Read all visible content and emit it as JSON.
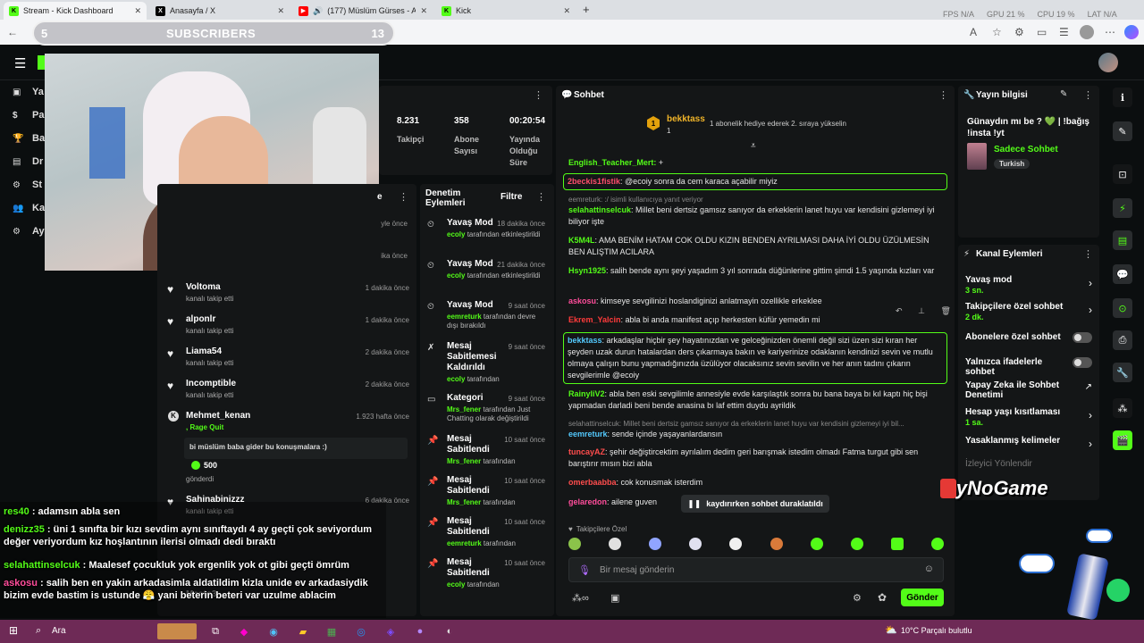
{
  "browser": {
    "tabs": [
      "Stream - Kick Dashboard",
      "Anasayfa / X",
      "(177) Müslüm Gürses - Affet",
      "Kick"
    ],
    "perf": {
      "fps": "FPS N/A",
      "gpu": "GPU 21 %",
      "cpu": "CPU 19 %",
      "lat": "LAT N/A"
    }
  },
  "subs_overlay": {
    "left": "5",
    "label": "SUBSCRIBERS",
    "right": "13"
  },
  "nav": [
    {
      "label": "Ya",
      "icon": "video-icon"
    },
    {
      "label": "Pa",
      "icon": "dollar-icon"
    },
    {
      "label": "Ba",
      "icon": "trophy-icon"
    },
    {
      "label": "Dr",
      "icon": "gift-icon"
    },
    {
      "label": "St",
      "icon": "gear-icon"
    },
    {
      "label": "Ka",
      "icon": "users-icon"
    },
    {
      "label": "Ay",
      "icon": "gear-icon"
    }
  ],
  "stats": [
    {
      "value": "8.231",
      "label": "Takipçi"
    },
    {
      "value": "358",
      "label": "Abone Sayısı"
    },
    {
      "value": "00:20:54",
      "label": "Yayında Olduğu Süre"
    }
  ],
  "activity": {
    "header_suffix": "e",
    "items": [
      {
        "name": "Voltoma",
        "sub": "kanalı takip etti",
        "time": "1 dakika önce"
      },
      {
        "name": "alponlr",
        "sub": "kanalı takip etti",
        "time": "1 dakika önce"
      },
      {
        "name": "Liama54",
        "sub": "kanalı takip etti",
        "time": "2 dakika önce"
      },
      {
        "name": "Incomptible",
        "sub": "kanalı takip etti",
        "time": "2 dakika önce"
      },
      {
        "name": "Mehmet_kenan",
        "sub": ", Rage Quit",
        "time": "1.923 hafta önce"
      },
      {
        "name": "Sahinabinizzz",
        "sub": "kanalı takip etti",
        "time": "6 dakika önce"
      }
    ],
    "partial_time_1": "yle önce",
    "partial_time_2": "ika önce",
    "mehmet_message": "bi müslüm baba gider bu konuşmalara :)",
    "mehmet_amount": "500",
    "mehmet_footer": "gönderdi",
    "bottom_partial": "Mceto3"
  },
  "mod": {
    "title": "Denetim Eylemleri",
    "filter": "Filtre",
    "items": [
      {
        "title": "Yavaş Mod",
        "time": "18 dakika önce",
        "user": "ecoly",
        "desc": "tarafından etkinleştirildi",
        "icon": "slow-mode-icon"
      },
      {
        "title": "Yavaş Mod",
        "time": "21 dakika önce",
        "user": "ecoly",
        "desc": "tarafından etkinleştirildi",
        "icon": "slow-mode-icon"
      },
      {
        "title": "Yavaş Mod",
        "time": "9 saat önce",
        "user": "eemreturk",
        "desc": "tarafından devre dışı bırakıldı",
        "icon": "slow-mode-icon"
      },
      {
        "title": "Mesaj Sabitlemesi Kaldırıldı",
        "time": "9 saat önce",
        "user": "ecoly",
        "desc": "tarafından",
        "icon": "unpin-icon"
      },
      {
        "title": "Kategori",
        "time": "9 saat önce",
        "user": "Mrs_fener",
        "desc": "tarafından Just Chatting olarak değiştirildi",
        "icon": "category-icon"
      },
      {
        "title": "Mesaj Sabitlendi",
        "time": "10 saat önce",
        "user": "Mrs_fener",
        "desc": "tarafından",
        "icon": "pin-icon"
      },
      {
        "title": "Mesaj Sabitlendi",
        "time": "10 saat önce",
        "user": "Mrs_fener",
        "desc": "tarafından",
        "icon": "pin-icon"
      },
      {
        "title": "Mesaj Sabitlendi",
        "time": "10 saat önce",
        "user": "eemreturk",
        "desc": "tarafından",
        "icon": "pin-icon"
      },
      {
        "title": "Mesaj Sabitlendi",
        "time": "10 saat önce",
        "user": "ecoly",
        "desc": "tarafından",
        "icon": "pin-icon"
      }
    ]
  },
  "chat": {
    "title": "Sohbet",
    "top_user": "bekktass",
    "top_rank": "1",
    "top_count": "1",
    "top_note": "1 abonelik hediye ederek 2. sıraya yükselin",
    "messages": [
      {
        "user": "English_Teacher_Mert:",
        "text": " +",
        "color": "#53fc18"
      },
      {
        "user": "2beckis1fistik",
        "text": ": @ecoiy sonra da cem karaca açabilir miyiz",
        "color": "#ff4d6d",
        "boxed": true
      },
      {
        "reply": "eemreturk: :/ isimli kullanıcıya yanıt veriyor"
      },
      {
        "user": "selahattinselcuk",
        "text": ": Millet beni dertsiz gamsız sanıyor da erkeklerin lanet huyu var kendisini gizlemeyi iyi biliyor işte",
        "color": "#53fc18"
      },
      {
        "user": "K5M4L",
        "text": ": AMA BENİM HATAM COK OLDU KIZIN BENDEN AYRILMASI DAHA İYİ OLDU ÜZÜLMESİN BEN ALIŞTIM ACILARA",
        "color": "#53fc18"
      },
      {
        "user": "Hsyn1925",
        "text": ": salih bende aynı şeyi yaşadım 3 yıl sonrada düğünlerine gittim şimdi 1.5 yaşında kızları var",
        "color": "#53fc18"
      },
      {
        "user": "askosu",
        "text": ": kimseye sevgilinizi hoslandiginizi anlatmayin ozellikle erkeklee",
        "color": "#ff4d9b"
      },
      {
        "user": "Ekrem_Yalcin",
        "text": ": abla bi anda manifest açıp herkesten küfür yemedin mi",
        "color": "#ff3b3b"
      },
      {
        "user": "bekktass",
        "text": ": arkadaşlar hiçbir şey hayatınızdan ve gelceğinizden önemli değil sizi üzen sizi kıran her şeyden uzak durun hatalardan ders çıkarmaya bakın ve kariyerinize odaklanın kendinizi sevin ve mutlu olmaya çalışın bunu yapmadığınızda üzülüyor olacaksınız sevin sevilin ve her anın tadını çıkarın sevgilerimle @ecoiy",
        "color": "#53c8fc",
        "boxed": true
      },
      {
        "user": "RainyliV2",
        "text": ": abla ben eski sevgilimle annesiyle evde karşılaştık sonra bu bana baya bı kıl kaptı hiç bişi yapmadan darladi beni bende anasina bı laf ettim duydu ayrildik",
        "color": "#53fc18"
      },
      {
        "reply": "selahattinselcuk: Millet beni dertsiz gamsız sanıyor da erkeklerin lanet huyu var kendisini gizlemeyi iyi bil..."
      },
      {
        "user": "eemreturk",
        "text": ": sende içinde yaşayanlardansın",
        "color": "#53c8fc"
      },
      {
        "user": "tuncayAZ",
        "text": ": şehir değiştircektim ayrılalım dedim geri barışmak istedim olmadı Fatma turgut gibi sen barıştırır mısın bizi abla",
        "color": "#ff4d4d"
      },
      {
        "user": "omerbaabba",
        "text": ": cok konusmak isterdim",
        "color": "#ff4d4d"
      },
      {
        "user": "gelaredon",
        "text": ": ailene guven",
        "color": "#ff4d9b"
      }
    ],
    "paused": "kaydırırken sohbet duraklatıldı",
    "emote_label": "Takipçilere Özel",
    "input_placeholder": "Bir mesaj gönderin",
    "send": "Gönder"
  },
  "stream_info": {
    "title": "Yayın bilgisi",
    "text": "Günaydın mı be ? 💚 | !bağış !insta !yt",
    "category": "Sadece Sohbet",
    "tag": "Turkish"
  },
  "channel_actions": {
    "title": "Kanal Eylemleri",
    "items": [
      {
        "label": "Yavaş mod",
        "sub": "3 sn.",
        "control": "chevron"
      },
      {
        "label": "Takipçilere özel sohbet",
        "sub": "2 dk.",
        "control": "chevron"
      },
      {
        "label": "Abonelere özel sohbet",
        "sub": "",
        "control": "toggle"
      },
      {
        "label": "Yalnızca ifadelerle sohbet",
        "sub": "",
        "control": "toggle"
      },
      {
        "label": "Yapay Zeka ile Sohbet Denetimi",
        "sub": "",
        "control": "external"
      },
      {
        "label": "Hesap yaşı kısıtlaması",
        "sub": "1 sa.",
        "control": "chevron"
      },
      {
        "label": "Yasaklanmış kelimeler",
        "sub": "",
        "control": "chevron"
      },
      {
        "label": "İzleyici Yönlendir",
        "sub": "",
        "control": "none"
      }
    ]
  },
  "watermark": "ByNoGame",
  "overlay_chat": [
    {
      "user": "res40",
      "text": " : adamsın abla sen",
      "color": "#53fc18"
    },
    {
      "user": "denizz35",
      "text": " : üni 1 sınıfta bir kızı sevdim aynı sınıftaydı 4 ay geçti çok seviyordum değer veriyordum kız hoşlantının ilerisi olmadı dedi bıraktı",
      "color": "#53fc18"
    },
    {
      "user": "selahattinselcuk",
      "text": " : Maalesef çocukluk yok ergenlik yok ot gibi geçti ömrüm",
      "color": "#53fc18"
    },
    {
      "user": "askosu",
      "text": " : salih ben en yakin arkadasimla aldatildim kizla unide ev arkadasiydik bizim evde bastim is ustunde 😤 yani beterin beteri var uzulme ablacim",
      "color": "#ff4d9b"
    }
  ],
  "taskbar": {
    "search": "Ara",
    "weather": "10°C  Parçalı bulutlu"
  }
}
